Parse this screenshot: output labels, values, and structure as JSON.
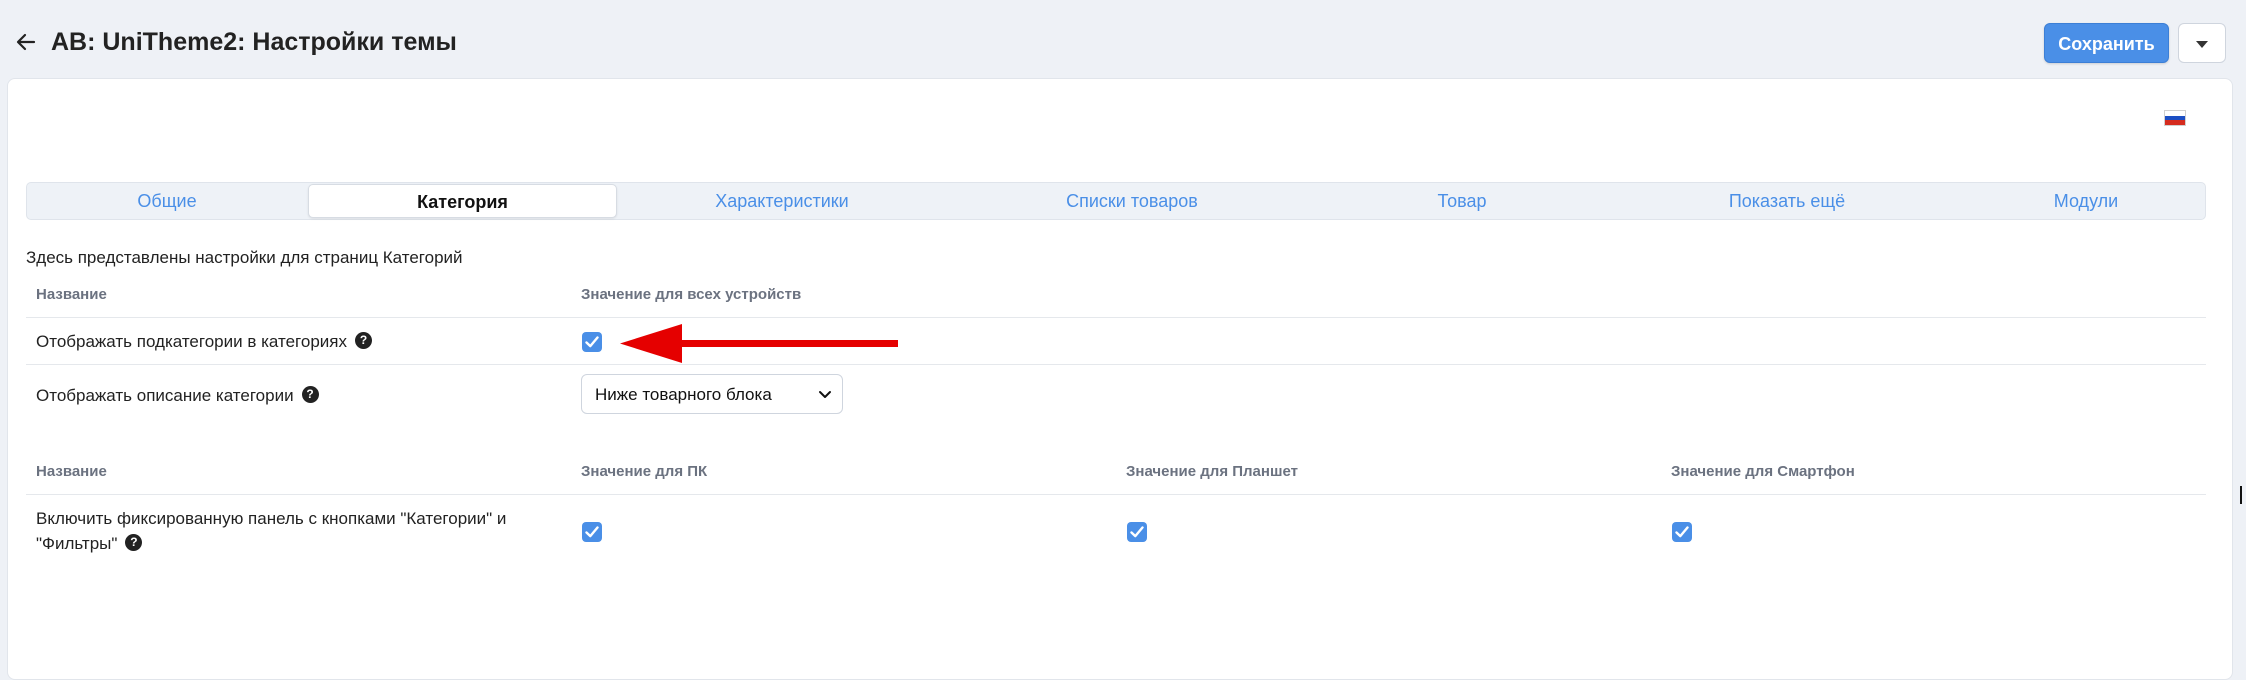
{
  "header": {
    "title": "AB: UniTheme2: Настройки темы",
    "save_label": "Сохранить",
    "accent_color": "#4a8fe7"
  },
  "language_flag": "russian-flag-icon",
  "tabs": [
    {
      "label": "Общие",
      "active": false
    },
    {
      "label": "Категория",
      "active": true
    },
    {
      "label": "Характеристики",
      "active": false
    },
    {
      "label": "Списки товаров",
      "active": false
    },
    {
      "label": "Товар",
      "active": false
    },
    {
      "label": "Показать ещё",
      "active": false
    },
    {
      "label": "Модули",
      "active": false
    }
  ],
  "description": "Здесь представлены настройки для страниц Категорий",
  "table1": {
    "headers": [
      "Название",
      "Значение для всех устройств"
    ],
    "rows": [
      {
        "label": "Отображать подкатегории в категориях",
        "checked": true
      },
      {
        "label": "Отображать описание категории",
        "select_value": "Ниже товарного блока"
      }
    ]
  },
  "table2": {
    "headers": [
      "Название",
      "Значение для ПК",
      "Значение для Планшет",
      "Значение для Смартфон"
    ],
    "rows": [
      {
        "label_line1": "Включить фиксированную панель с кнопками \"Категории\" и",
        "label_line2": "\"Фильтры\"",
        "pc": true,
        "tablet": true,
        "phone": true
      }
    ]
  },
  "annotation_arrow_color": "#e50000"
}
